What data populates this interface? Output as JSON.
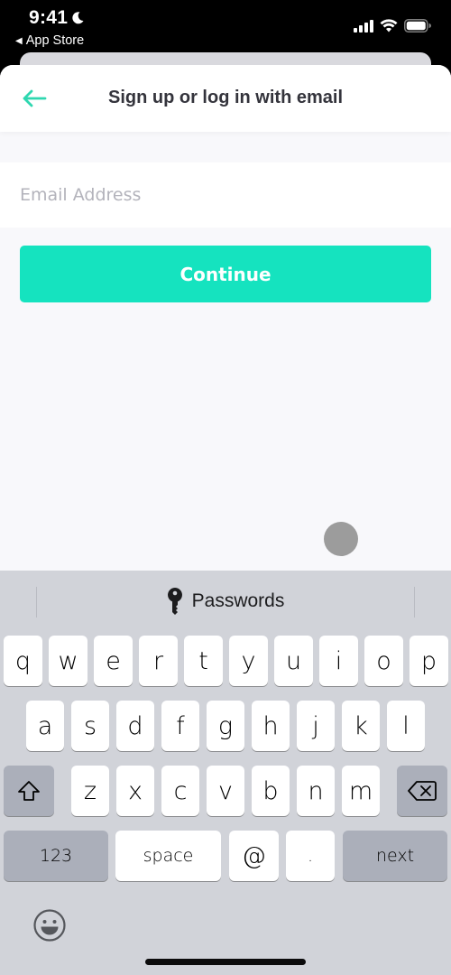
{
  "status_bar": {
    "time": "9:41",
    "back_app_label": "App Store",
    "icons": [
      "moon-icon",
      "cellular-signal-icon",
      "wifi-icon",
      "battery-icon"
    ]
  },
  "header": {
    "title": "Sign up or log in with email",
    "back_icon": "arrow-left-icon"
  },
  "form": {
    "email_placeholder": "Email Address",
    "email_value": "",
    "continue_label": "Continue"
  },
  "colors": {
    "accent": "#15e3bf",
    "title_text": "#34343c",
    "placeholder": "#b3b3bb",
    "background": "#f8f8fb",
    "keyboard_bg": "#d1d3d9"
  },
  "keyboard": {
    "passwords_label": "Passwords",
    "row1": [
      "q",
      "w",
      "e",
      "r",
      "t",
      "y",
      "u",
      "i",
      "o",
      "p"
    ],
    "row2": [
      "a",
      "s",
      "d",
      "f",
      "g",
      "h",
      "j",
      "k",
      "l"
    ],
    "row3": [
      "z",
      "x",
      "c",
      "v",
      "b",
      "n",
      "m"
    ],
    "numbers_label": "123",
    "space_label": "space",
    "at_label": "@",
    "dot_label": ".",
    "next_label": "next"
  }
}
